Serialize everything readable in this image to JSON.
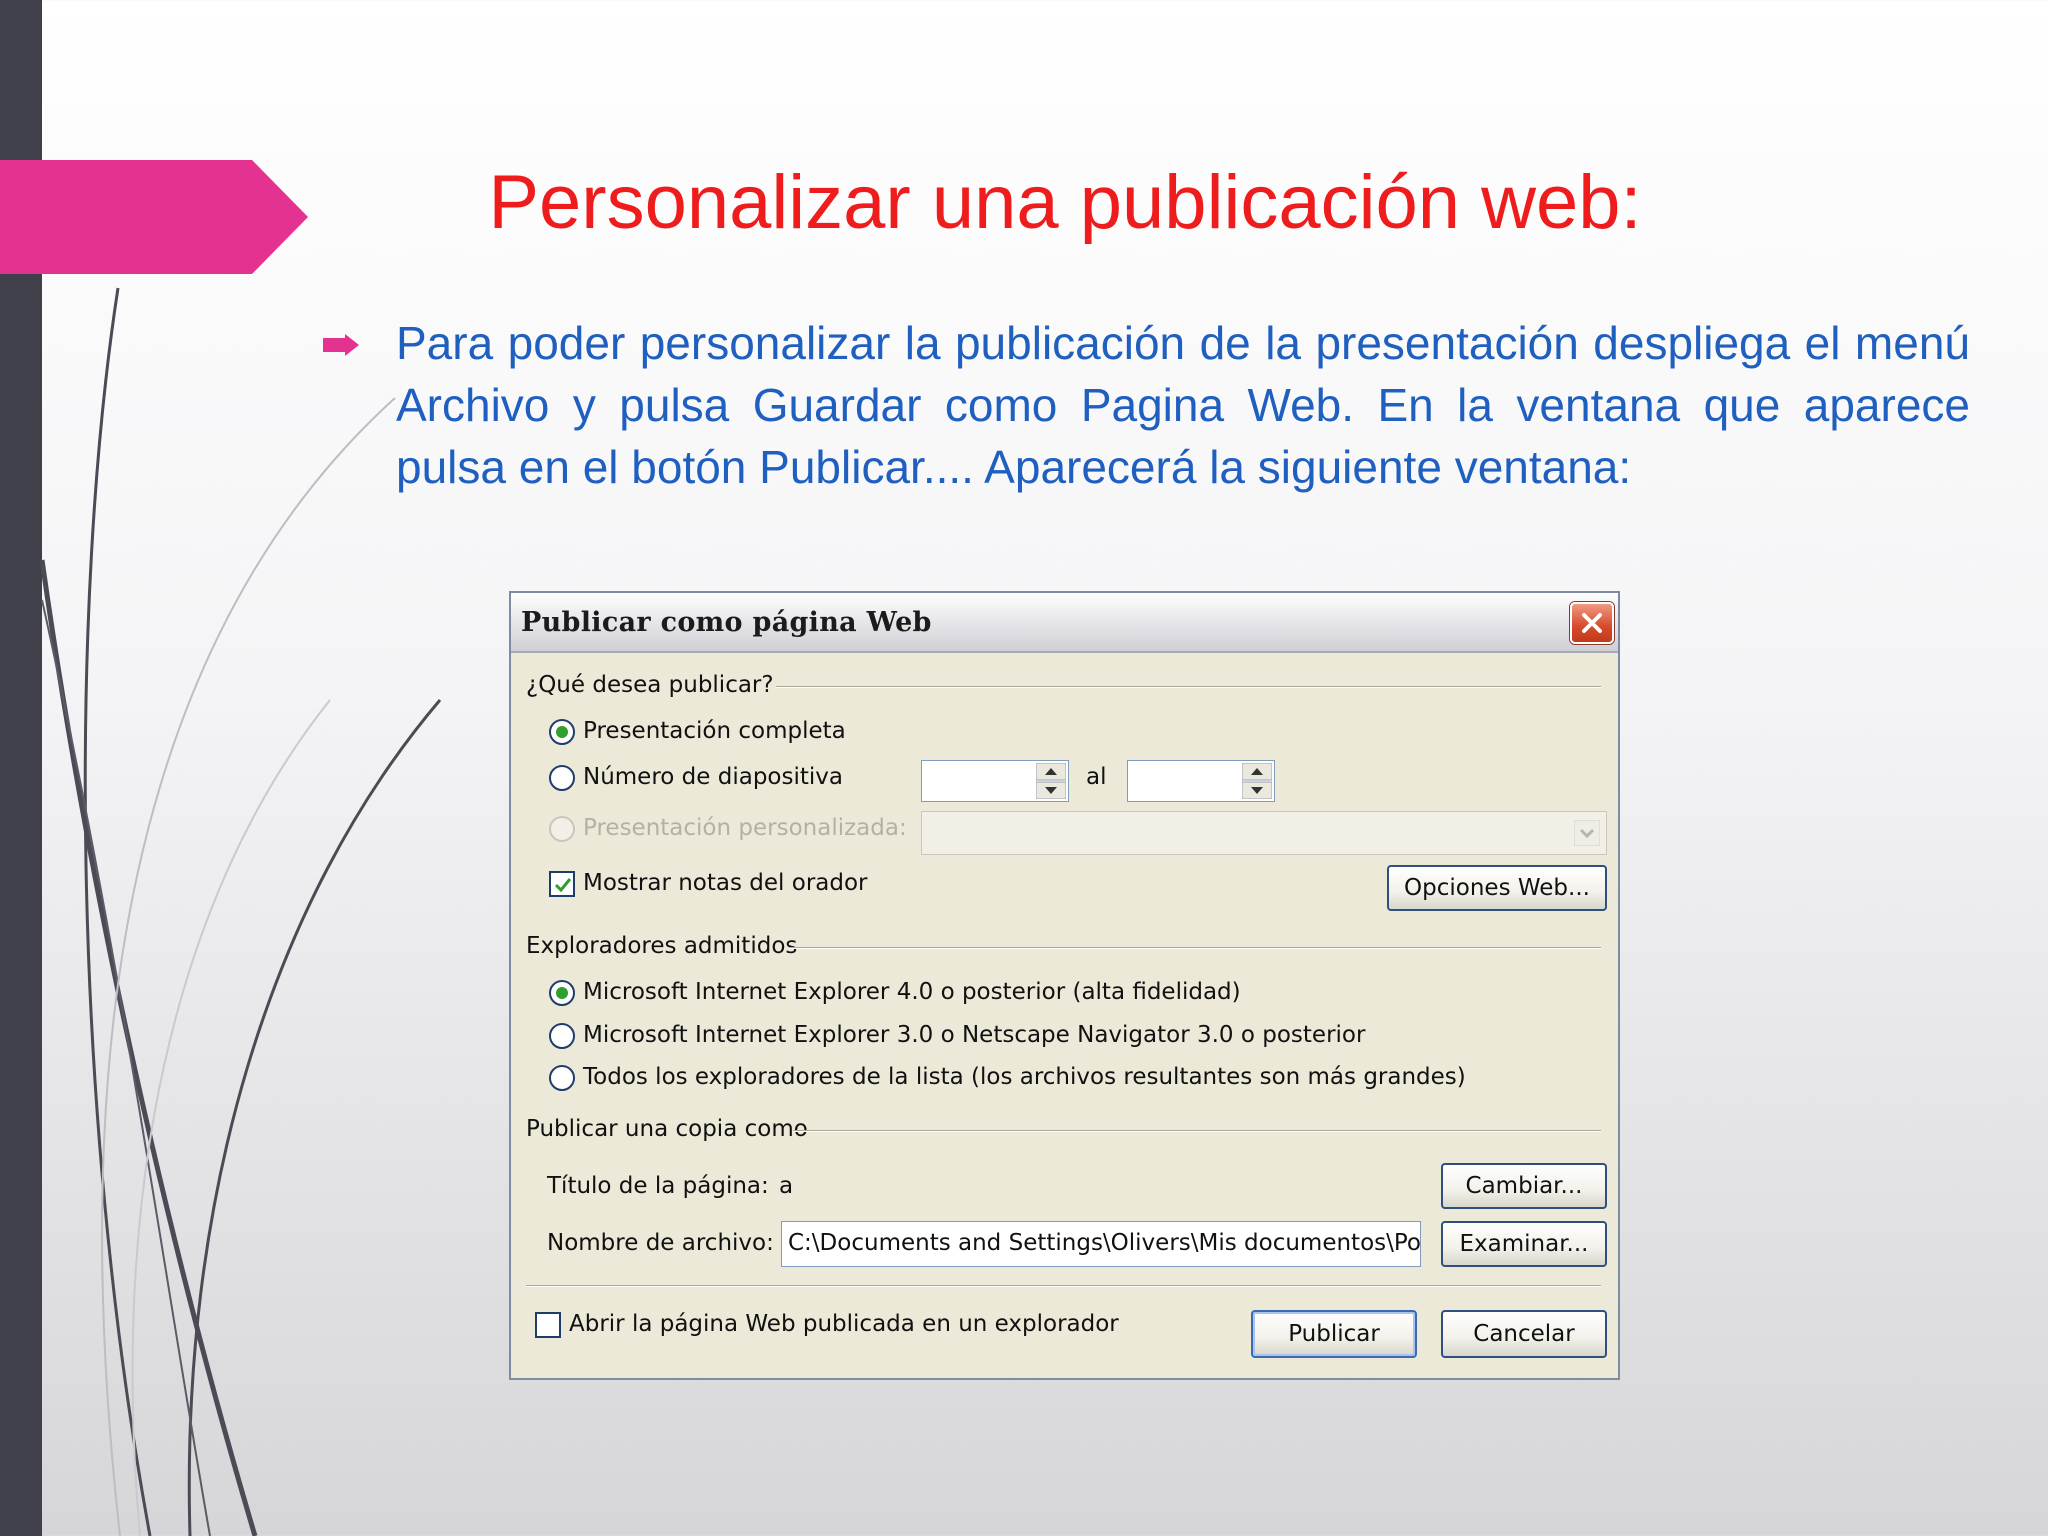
{
  "slide": {
    "title": "Personalizar una publicación web:",
    "body": "Para poder personalizar la publicación de la presentación despliega el menú Archivo y pulsa Guardar como Pagina Web. En la ventana que aparece pulsa en el botón Publicar.... Aparecerá la siguiente ventana:"
  },
  "dialog": {
    "title": "Publicar como página Web",
    "group_what": "¿Qué desea publicar?",
    "opt_full": "Presentación completa",
    "opt_slide_number": "Número de diapositiva",
    "range_to": "al",
    "opt_custom": "Presentación personalizada:",
    "show_notes": "Mostrar notas del orador",
    "web_options_button": "Opciones Web...",
    "group_browsers": "Exploradores admitidos",
    "browser_ie4": "Microsoft Internet Explorer 4.0 o posterior (alta fidelidad)",
    "browser_ie3": "Microsoft Internet Explorer 3.0 o Netscape Navigator 3.0 o posterior",
    "browser_all": "Todos los exploradores de la lista (los archivos resultantes son más grandes)",
    "group_copy": "Publicar una copia como",
    "page_title_label": "Título de la página:",
    "page_title_value": "a",
    "change_button": "Cambiar...",
    "filename_label": "Nombre de archivo:",
    "filename_value": "C:\\Documents and Settings\\Olivers\\Mis documentos\\Powe",
    "browse_button": "Examinar...",
    "open_in_browser": "Abrir la página Web publicada en un explorador",
    "publish_button": "Publicar",
    "cancel_button": "Cancelar"
  },
  "colors": {
    "title": "#ee1c1c",
    "body": "#1f5fbf",
    "accent_pink": "#e3328f",
    "sidebar": "#3f4049"
  }
}
